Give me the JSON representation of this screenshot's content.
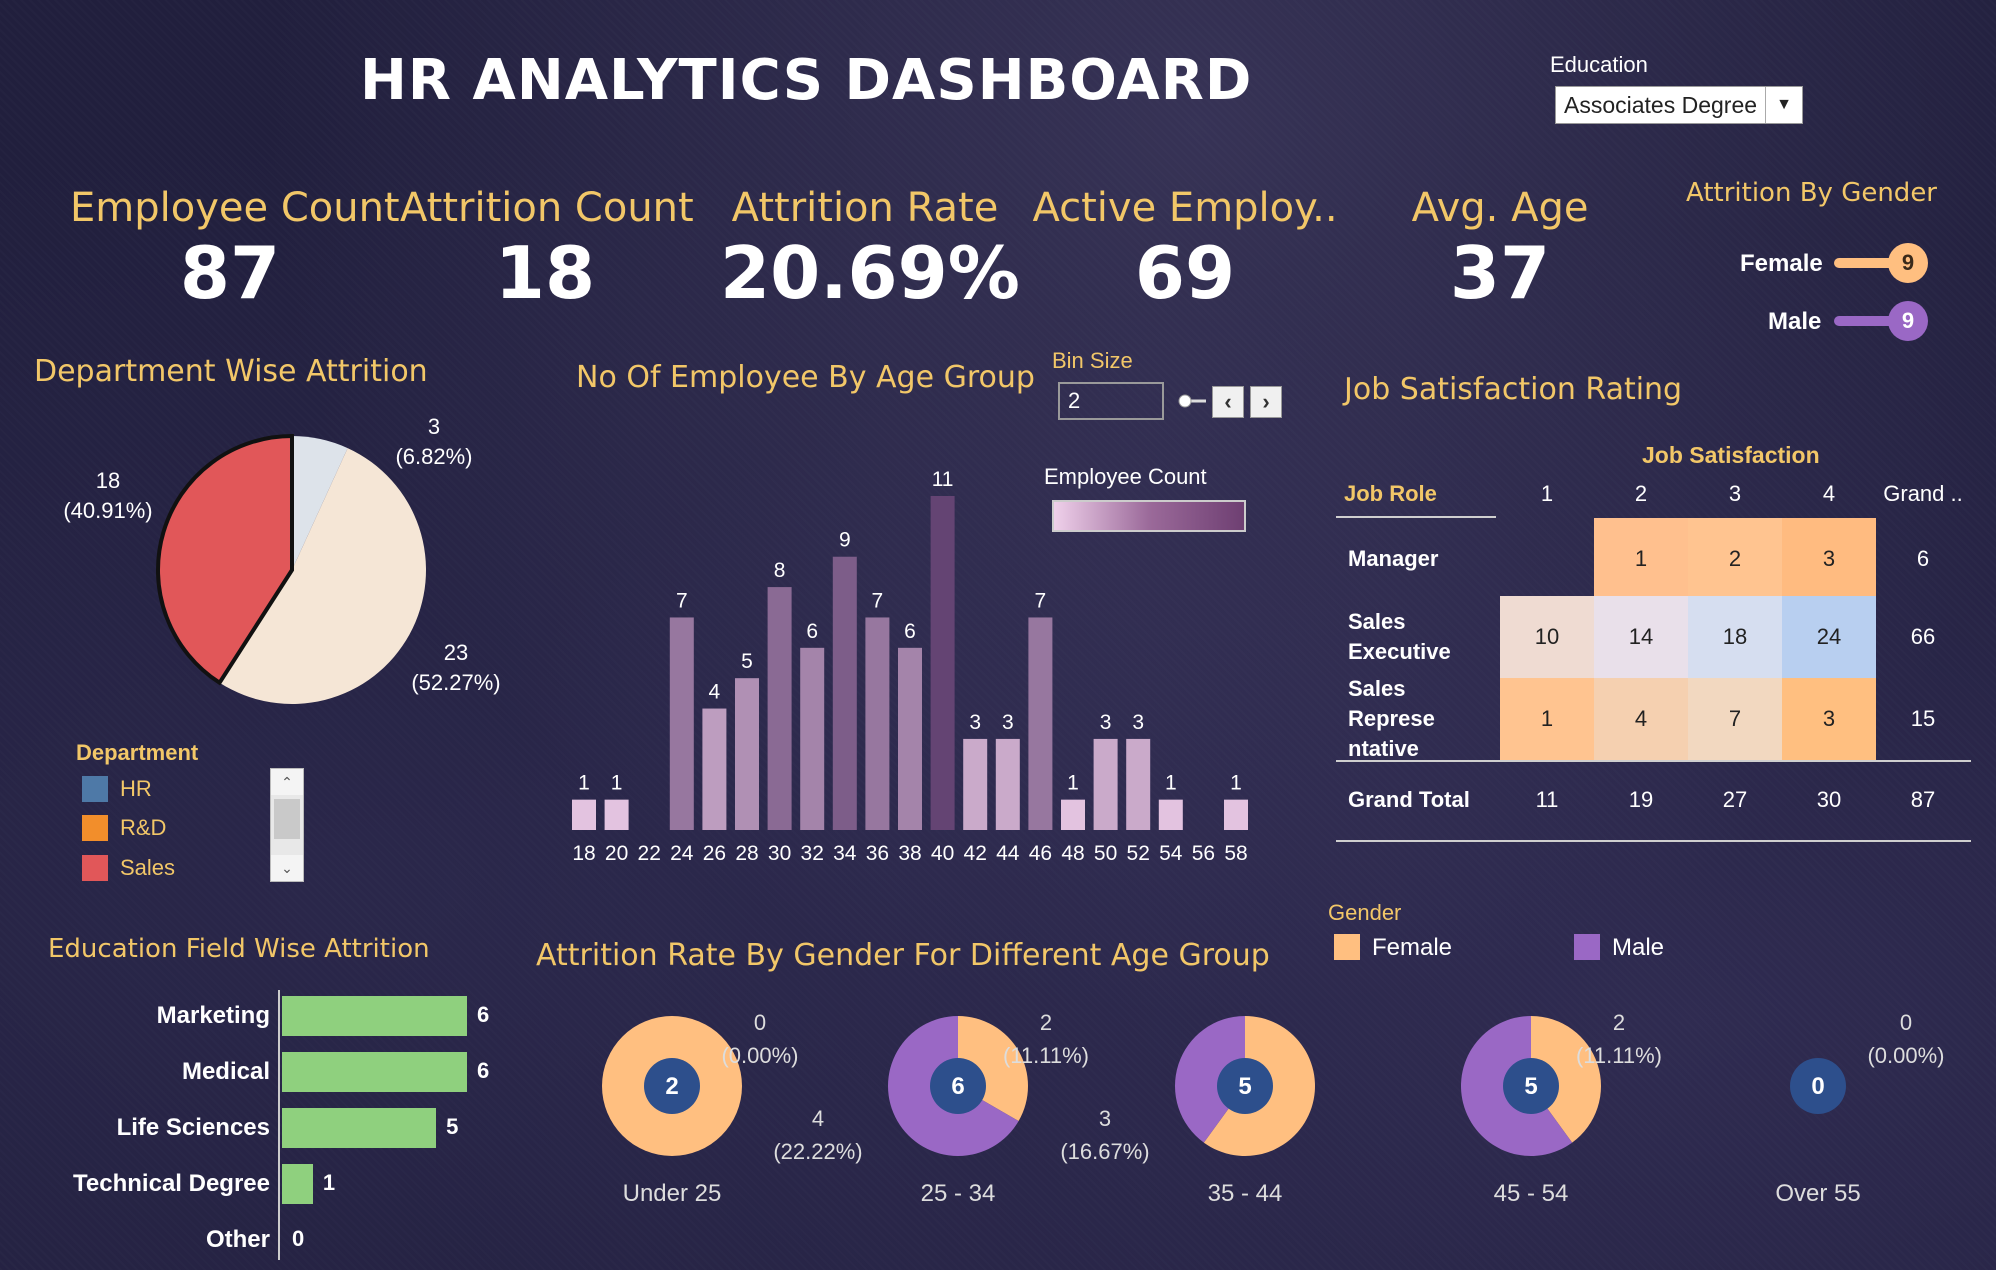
{
  "title": "HR ANALYTICS DASHBOARD",
  "filter": {
    "label": "Education",
    "selected": "Associates Degree"
  },
  "kpis": [
    {
      "label": "Employee Count",
      "value": "87"
    },
    {
      "label": "Attrition Count",
      "value": "18"
    },
    {
      "label": "Attrition Rate",
      "value": "20.69%"
    },
    {
      "label": "Active Employ..",
      "value": "69"
    },
    {
      "label": "Avg. Age",
      "value": "37"
    }
  ],
  "attrition_by_gender": {
    "title": "Attrition By Gender",
    "items": [
      {
        "label": "Female",
        "value": "9",
        "color": "#ffbf80"
      },
      {
        "label": "Male",
        "value": "9",
        "color": "#9a68c5"
      }
    ]
  },
  "department": {
    "title": "Department Wise Attrition",
    "legend_title": "Department",
    "legend": [
      {
        "label": "HR",
        "color": "#4e79a7"
      },
      {
        "label": "R&D",
        "color": "#f28e2b"
      },
      {
        "label": "Sales",
        "color": "#e15759"
      }
    ],
    "labels": [
      {
        "count": "3",
        "pct": "(6.82%)"
      },
      {
        "count": "23",
        "pct": "(52.27%)"
      },
      {
        "count": "18",
        "pct": "(40.91%)"
      }
    ]
  },
  "age_group": {
    "title": "No Of Employee By Age Group",
    "bin_label": "Bin Size",
    "bin_value": "2",
    "legend_label": "Employee Count"
  },
  "job_satisfaction": {
    "title": "Job Satisfaction Rating",
    "header_group": "Job Satisfaction",
    "row_header": "Job Role",
    "columns": [
      "1",
      "2",
      "3",
      "4",
      "Grand .."
    ],
    "rows": [
      {
        "label": "Manager",
        "values": [
          "",
          "1",
          "2",
          "3",
          "6"
        ]
      },
      {
        "label": "Sales Executive",
        "label_lines": [
          "Sales",
          "Executive"
        ],
        "values": [
          "10",
          "14",
          "18",
          "24",
          "66"
        ]
      },
      {
        "label": "Sales Representative",
        "label_lines": [
          "Sales Represe",
          "ntative"
        ],
        "values": [
          "1",
          "4",
          "7",
          "3",
          "15"
        ]
      },
      {
        "label": "Grand Total",
        "values": [
          "11",
          "19",
          "27",
          "30",
          "87"
        ]
      }
    ]
  },
  "education_field": {
    "title": "Education Field Wise Attrition",
    "items": [
      {
        "label": "Marketing",
        "value": "6"
      },
      {
        "label": "Medical",
        "value": "6"
      },
      {
        "label": "Life Sciences",
        "value": "5"
      },
      {
        "label": "Technical Degree",
        "value": "1"
      },
      {
        "label": "Other",
        "value": "0"
      }
    ]
  },
  "gender_age": {
    "title": "Attrition Rate By Gender For Different Age Group",
    "legend_title": "Gender",
    "legend": [
      {
        "label": "Female",
        "color": "#ffbf80"
      },
      {
        "label": "Male",
        "color": "#9a68c5"
      }
    ],
    "groups": [
      {
        "label": "Under 25",
        "center": "2",
        "anno1": [
          "0",
          "(0.00%)"
        ]
      },
      {
        "label": "25 - 34",
        "center": "6",
        "anno1": [
          "2",
          "(11.11%)"
        ],
        "anno2": [
          "4",
          "(22.22%)"
        ]
      },
      {
        "label": "35 - 44",
        "center": "5",
        "anno2": [
          "3",
          "(16.67%)"
        ]
      },
      {
        "label": "45 - 54",
        "center": "5",
        "anno1": [
          "2",
          "(11.11%)"
        ]
      },
      {
        "label": "Over 55",
        "center": "0",
        "anno1": [
          "0",
          "(0.00%)"
        ]
      }
    ]
  },
  "chart_data": [
    {
      "type": "pie",
      "title": "Department Wise Attrition",
      "categories": [
        "HR",
        "R&D",
        "Sales"
      ],
      "values": [
        3,
        23,
        18
      ],
      "percent": [
        6.82,
        52.27,
        40.91
      ]
    },
    {
      "type": "bar",
      "title": "No Of Employee By Age Group",
      "categories": [
        "18",
        "20",
        "22",
        "24",
        "26",
        "28",
        "30",
        "32",
        "34",
        "36",
        "38",
        "40",
        "42",
        "44",
        "46",
        "48",
        "50",
        "52",
        "54",
        "56",
        "58"
      ],
      "values": [
        1,
        1,
        0,
        7,
        4,
        5,
        8,
        6,
        9,
        7,
        6,
        11,
        3,
        3,
        7,
        1,
        3,
        3,
        1,
        0,
        1
      ],
      "ylim": [
        0,
        11
      ]
    },
    {
      "type": "bar",
      "title": "Education Field Wise Attrition",
      "categories": [
        "Marketing",
        "Medical",
        "Life Sciences",
        "Technical Degree",
        "Other"
      ],
      "values": [
        6,
        6,
        5,
        1,
        0
      ]
    },
    {
      "type": "pie",
      "title": "Attrition Rate By Gender For Different Age Group",
      "categories": [
        "Under 25",
        "25 - 34",
        "35 - 44",
        "45 - 54",
        "Over 55"
      ],
      "series": [
        {
          "name": "Female",
          "values": [
            2,
            2,
            3,
            2,
            0
          ]
        },
        {
          "name": "Male",
          "values": [
            0,
            4,
            2,
            3,
            0
          ]
        }
      ]
    }
  ]
}
